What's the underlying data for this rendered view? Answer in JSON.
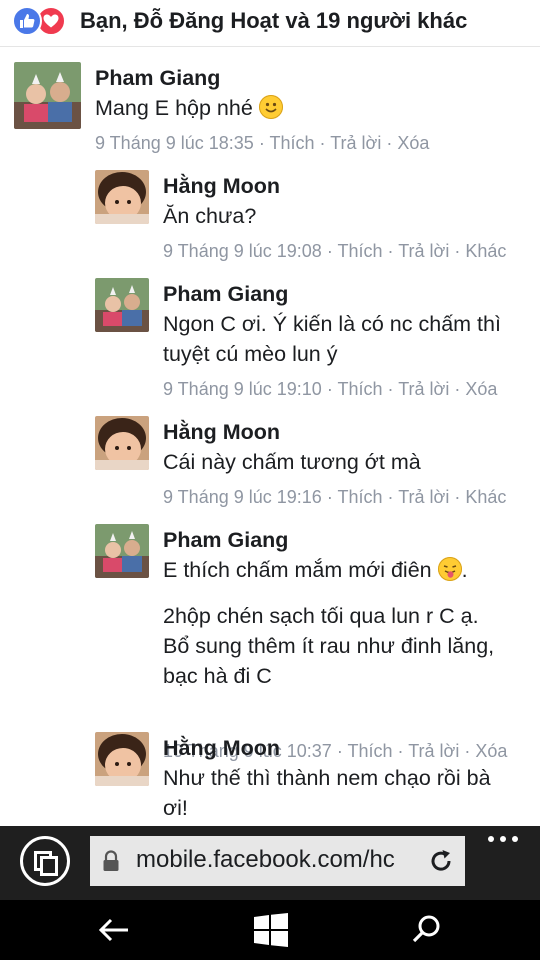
{
  "reactions": {
    "icons": [
      "like-icon",
      "love-icon"
    ],
    "summary": "Bạn, Đỗ Đăng Hoạt và 19 người khác"
  },
  "comments": [
    {
      "author": "Pham Giang",
      "avatar": "pham-giang-avatar",
      "text_lines": [
        "Mang E hộp nhé"
      ],
      "emoji": "smile-emoji",
      "time": "9 Tháng 9 lúc 18:35",
      "actions": [
        "Thích",
        "Trả lời",
        "Xóa"
      ]
    },
    {
      "author": "Hằng Moon",
      "avatar": "hang-moon-avatar",
      "text_lines": [
        "Ăn chưa?"
      ],
      "time": "9 Tháng 9 lúc 19:08",
      "actions": [
        "Thích",
        "Trả lời",
        "Khác"
      ]
    },
    {
      "author": "Pham Giang",
      "avatar": "pham-giang-avatar",
      "text_lines": [
        "Ngon C ơi. Ý kiến là có nc chấm thì",
        "tuyệt cú mèo lun ý"
      ],
      "time": "9 Tháng 9 lúc 19:10",
      "actions": [
        "Thích",
        "Trả lời",
        "Xóa"
      ]
    },
    {
      "author": "Hằng Moon",
      "avatar": "hang-moon-avatar",
      "text_lines": [
        "Cái này chấm tương ớt mà"
      ],
      "time": "9 Tháng 9 lúc 19:16",
      "actions": [
        "Thích",
        "Trả lời",
        "Khác"
      ]
    },
    {
      "author": "Pham Giang",
      "avatar": "pham-giang-avatar",
      "text_lines": [
        "E thích chấm mắm mới điên",
        "",
        "2hộp chén sạch tối qua lun r C ạ.",
        "Bổ sung thêm ít rau như đinh lăng,",
        "bạc hà đi C"
      ],
      "emoji_after_first": "tongue-emoji",
      "time": "10 Tháng 9 lúc 10:37",
      "actions": [
        "Thích",
        "Trả lời",
        "Xóa"
      ]
    },
    {
      "author": "Hằng Moon",
      "avatar": "hang-moon-avatar",
      "text_lines": [
        "Như thế thì thành nem chạo rồi bà",
        "ơi!"
      ]
    }
  ],
  "browser": {
    "url": "mobile.facebook.com/hc",
    "tabs_icon": "tabs-icon",
    "lock_icon": "lock-icon",
    "refresh_icon": "refresh-icon",
    "more_icon": "more-icon"
  },
  "taskbar": {
    "back_icon": "back-icon",
    "windows_icon": "windows-icon",
    "search_icon": "search-icon"
  },
  "colors": {
    "like": "#4a78e8",
    "love": "#f03a4f",
    "meta_text": "#8f96a2",
    "browser_bar": "#1f1f1f",
    "nav_bar": "#000000"
  }
}
